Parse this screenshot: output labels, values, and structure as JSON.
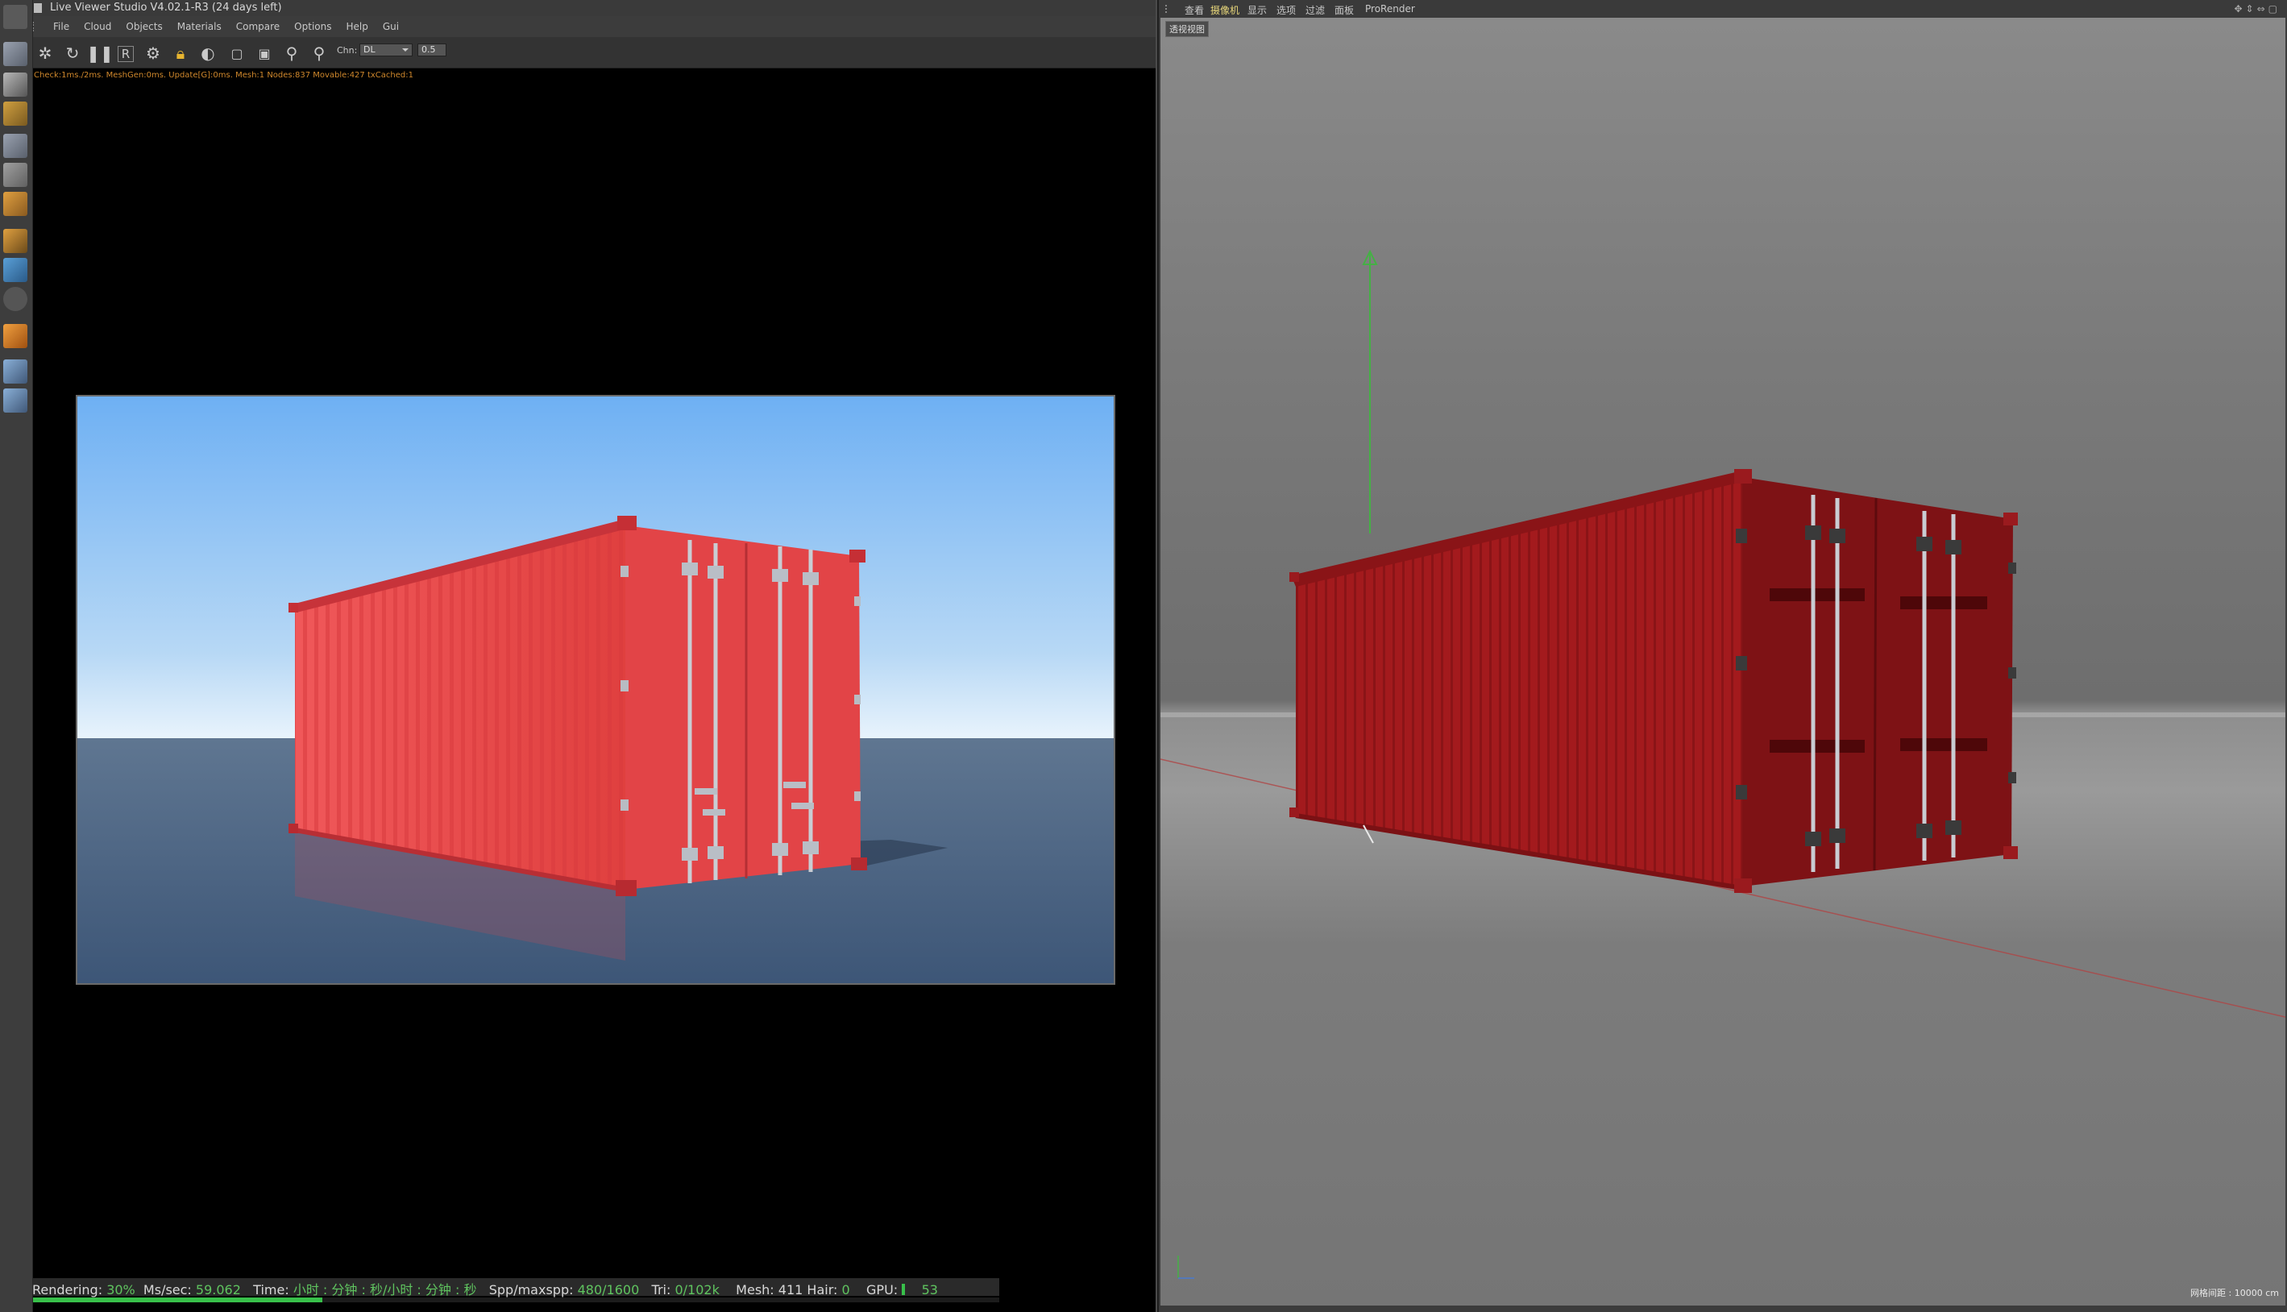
{
  "window": {
    "title": "Live Viewer Studio V4.02.1-R3 (24 days left)"
  },
  "live_viewer": {
    "menu": [
      "File",
      "Cloud",
      "Objects",
      "Materials",
      "Compare",
      "Options",
      "Help",
      "Gui"
    ],
    "toolbar": {
      "channel_label": "Chn:",
      "channel_value": "DL",
      "zoom_value": "0.5"
    },
    "stats_line": "Check:1ms./2ms. MeshGen:0ms. Update[G]:0ms. Mesh:1 Nodes:837 Movable:427 txCached:1",
    "status": {
      "rendering_label": "Rendering:",
      "rendering_value": "30%",
      "mssec_label": "Ms/sec:",
      "mssec_value": "59.062",
      "time_label": "Time:",
      "time_value": "小时 : 分钟 : 秒/小时 : 分钟 : 秒",
      "spp_label": "Spp/maxspp:",
      "spp_value": "480/1600",
      "tri_label": "Tri:",
      "tri_value": "0/102k",
      "mesh_label": "Mesh:",
      "mesh_value": "411",
      "hair_label": "Hair:",
      "hair_value": "0",
      "gpu_label": "GPU:",
      "gpu_value": "53",
      "progress_fraction": 0.3
    }
  },
  "viewport": {
    "menu": [
      "查看",
      "摄像机",
      "显示",
      "选项",
      "过滤",
      "面板",
      "ProRender"
    ],
    "active_menu_index": 1,
    "camera_label": "透视视图",
    "grid_label": "网格间距 : 10000 cm"
  },
  "colors": {
    "accent_green": "#38c04a",
    "status_value": "#5fc45f",
    "stats_text": "#d0882c",
    "container_red_render": "#e8494c",
    "container_red_viewport": "#a51a1d"
  }
}
